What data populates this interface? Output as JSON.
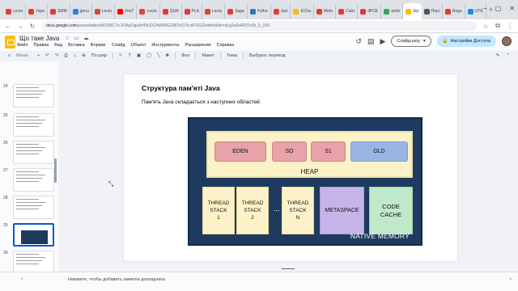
{
  "browser": {
    "tabs": [
      {
        "label": "Lectu",
        "color": "#db4437"
      },
      {
        "label": "Укра",
        "color": "#e53935"
      },
      {
        "label": "SMM",
        "color": "#e53935"
      },
      {
        "label": "genu",
        "color": "#1e88e5"
      },
      {
        "label": "Lectu",
        "color": "#db4437"
      },
      {
        "label": "YouT",
        "color": "#ff0000"
      },
      {
        "label": "Lectu",
        "color": "#db4437"
      },
      {
        "label": "QUA",
        "color": "#e53935"
      },
      {
        "label": "PLA",
        "color": "#e53935"
      },
      {
        "label": "Lectu",
        "color": "#db4437"
      },
      {
        "label": "Зада",
        "color": "#e53935"
      },
      {
        "label": "Pytho",
        "color": "#3776ab"
      },
      {
        "label": "Javi",
        "color": "#e53935"
      },
      {
        "label": "ECha",
        "color": "#fbbc04"
      },
      {
        "label": "Meto",
        "color": "#e53935"
      },
      {
        "label": "Calci",
        "color": "#e53935"
      },
      {
        "label": "dPCE",
        "color": "#e53935"
      },
      {
        "label": "ambi",
        "color": "#34a853"
      },
      {
        "label": "Що",
        "color": "#fbbc04",
        "active": true
      },
      {
        "label": "Пері",
        "color": "#555555"
      },
      {
        "label": "Rego",
        "color": "#e53935"
      },
      {
        "label": "UTE",
        "color": "#1e88e5"
      }
    ],
    "url_host": "docs.google.com",
    "url_path": "/presentation/d/19NC7o-XVApOgu4rH3rSX24dXMG2587eD7hcAFSGZIedit#slide=id.g2a9a4f2f7c6b_0_243",
    "window_controls": [
      "–",
      "▢",
      "✕"
    ]
  },
  "app": {
    "title": "Що таке Java",
    "menu": [
      "Файл",
      "Правка",
      "Вид",
      "Вставка",
      "Формат",
      "Слайд",
      "Объект",
      "Инструменты",
      "Расширения",
      "Справка"
    ],
    "slideshow_label": "Слайд-шоу",
    "share_label": "Настройки Доступа"
  },
  "toolbar": {
    "search_placeholder": "Меню",
    "zoom": "По шир",
    "background": "Фон",
    "layout": "Макет",
    "theme": "Тема",
    "transition": "Выбрать переход"
  },
  "filmstrip": {
    "slides": [
      {
        "number": "24"
      },
      {
        "number": "25"
      },
      {
        "number": "26"
      },
      {
        "number": "27"
      },
      {
        "number": "28"
      },
      {
        "number": "29",
        "selected": true
      },
      {
        "number": "30"
      }
    ]
  },
  "slide": {
    "title": "Структура пам'яті Java",
    "text": "Пам'ять Java складається з наступних областей:",
    "heap_segments": [
      {
        "label": "EDEN",
        "color": "#e8a2a8"
      },
      {
        "label": "SO",
        "color": "#e8a2a8"
      },
      {
        "label": "S1",
        "color": "#e8a2a8"
      },
      {
        "label": "OLD",
        "color": "#98b5e3"
      }
    ],
    "heap_label": "HEAP",
    "thread_stacks": [
      "THREAD\nSTACK\n1",
      "THREAD\nSTACK\n2",
      "THREAD\nSTACK\nN"
    ],
    "dots": "...",
    "metaspace": "METASPACE",
    "code_cache": "CODE\nCACHE",
    "native_memory": "NATIVE MEMORY"
  },
  "notes": {
    "placeholder": "Нажмите, чтобы добавить заметки докладчика"
  }
}
